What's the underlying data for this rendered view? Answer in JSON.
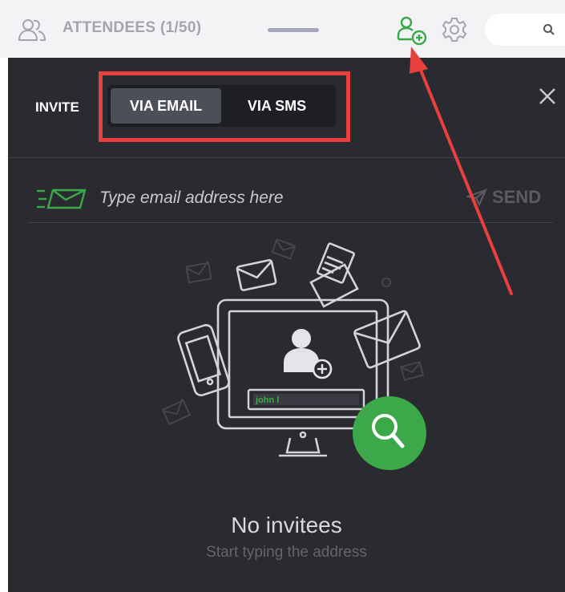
{
  "header": {
    "title": "ATTENDEES (1/50)",
    "search": {
      "value": ""
    }
  },
  "invite": {
    "label": "INVITE",
    "tabs": [
      {
        "label": "VIA EMAIL",
        "active": true
      },
      {
        "label": "VIA SMS",
        "active": false
      }
    ]
  },
  "email_row": {
    "placeholder": "Type email address here",
    "send_label": "SEND"
  },
  "illustration": {
    "name_field_value": "john l"
  },
  "empty_state": {
    "title": "No invitees",
    "subtitle": "Start typing the address"
  },
  "colors": {
    "panel_bg": "#2a2b30",
    "accent_green": "#3ba84a",
    "highlight_red": "#e8403d",
    "active_tab_bg": "#4c4e58"
  },
  "icons": [
    "people-icon",
    "add-user-icon",
    "gear-icon",
    "search-icon",
    "close-icon",
    "email-icon",
    "send-icon"
  ]
}
